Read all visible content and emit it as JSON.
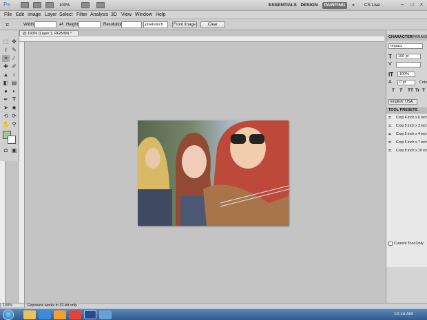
{
  "app": {
    "logo": "Ps",
    "zoom": "100%",
    "workspaces": [
      "ESSENTIALS",
      "DESIGN",
      "PAINTING"
    ],
    "cs_live": "CS Live",
    "more": "»"
  },
  "menus": [
    "File",
    "Edit",
    "Image",
    "Layer",
    "Select",
    "Filter",
    "Analysis",
    "3D",
    "View",
    "Window",
    "Help"
  ],
  "options": {
    "width_label": "Width:",
    "height_label": "Height:",
    "resolution_label": "Resolution:",
    "resolution_unit": "pixels/inch",
    "front_image": "Front Image",
    "clear": "Clear"
  },
  "document": {
    "tab_title": "@ 100% (Layer 1, RGB/8#) *",
    "status_zoom": "100%",
    "status_message": "Exposure works in 32-bit only"
  },
  "character": {
    "tabs": [
      "CHARACTER",
      "PARAGR"
    ],
    "font": "Impact",
    "size": "100 pt",
    "scale": "100%",
    "tracking": "0 pt",
    "color_label": "Colo",
    "language": "English: USA",
    "styles": [
      "T",
      "T",
      "TT",
      "Tr",
      "T"
    ]
  },
  "tool_presets": {
    "title": "TOOL PRESETS",
    "items": [
      "Crop 4 inch x 6 inch",
      "Crop 5 inch x 3 inch",
      "Crop 5 inch x 4 inch",
      "Crop 5 inch x 7 inch",
      "Crop 8 inch x 10 inch"
    ],
    "current_only": "Current Tool Only"
  },
  "taskbar": {
    "time": "10:14 AM"
  },
  "colors": {
    "accent": "#6f6f6f",
    "taskbar": "#2e5a8e",
    "swatch_fg": "#a8c89a"
  }
}
